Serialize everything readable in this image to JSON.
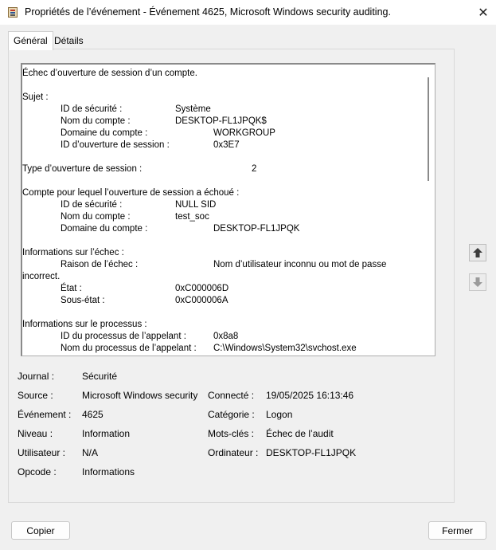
{
  "window": {
    "title": "Propriétés de l’événement - Événement 4625, Microsoft Windows security auditing.",
    "close_glyph": "✕"
  },
  "tabs": [
    {
      "label": "Général",
      "active": true
    },
    {
      "label": "Détails",
      "active": false
    }
  ],
  "description": {
    "lines": [
      {
        "text": "Échec d’ouverture de session d’un compte.",
        "col": 0,
        "row": 0
      },
      {
        "text": "Sujet :",
        "col": 0,
        "row": 2
      },
      {
        "text": "ID de sécurité :",
        "col": 1,
        "row": 3,
        "value": "Système",
        "vcol": 2
      },
      {
        "text": "Nom du compte :",
        "col": 1,
        "row": 4,
        "value": "DESKTOP-FL1JPQK$",
        "vcol": 2
      },
      {
        "text": "Domaine du compte :",
        "col": 1,
        "row": 5,
        "value": "WORKGROUP",
        "vcol": 3
      },
      {
        "text": "ID d’ouverture de session :",
        "col": 1,
        "row": 6,
        "value": "0x3E7",
        "vcol": 3
      },
      {
        "text": "Type d’ouverture de session :",
        "col": 0,
        "row": 8,
        "value": "2",
        "vcol": 4
      },
      {
        "text": "Compte pour lequel l’ouverture de session a échoué :",
        "col": 0,
        "row": 10
      },
      {
        "text": "ID de sécurité :",
        "col": 1,
        "row": 11,
        "value": "NULL SID",
        "vcol": 2
      },
      {
        "text": "Nom du compte :",
        "col": 1,
        "row": 12,
        "value": "test_soc",
        "vcol": 2
      },
      {
        "text": "Domaine du compte :",
        "col": 1,
        "row": 13,
        "value": "DESKTOP-FL1JPQK",
        "vcol": 3
      },
      {
        "text": "Informations sur l’échec :",
        "col": 0,
        "row": 15
      },
      {
        "text": "Raison de l’échec :",
        "col": 1,
        "row": 16,
        "value": "Nom d’utilisateur inconnu ou mot de passe",
        "vcol": 3
      },
      {
        "text": "incorrect.",
        "col": 0,
        "row": 17
      },
      {
        "text": "État :",
        "col": 1,
        "row": 18,
        "value": "0xC000006D",
        "vcol": 2
      },
      {
        "text": "Sous-état :",
        "col": 1,
        "row": 19,
        "value": "0xC000006A",
        "vcol": 2
      },
      {
        "text": "Informations sur le processus :",
        "col": 0,
        "row": 21
      },
      {
        "text": "ID du processus de l’appelant :",
        "col": 1,
        "row": 22,
        "value": "0x8a8",
        "vcol": 3
      },
      {
        "text": "Nom du processus de l’appelant :",
        "col": 1,
        "row": 23,
        "value": "C:\\Windows\\System32\\svchost.exe",
        "vcol": 3
      }
    ]
  },
  "side_buttons": {
    "up_icon": "arrow-up-icon",
    "down_icon": "arrow-down-icon"
  },
  "info": {
    "journal_label": "Journal :",
    "journal_value": "Sécurité",
    "source_label": "Source :",
    "source_value": "Microsoft Windows security",
    "connecte_label": "Connecté :",
    "connecte_value": "19/05/2025 16:13:46",
    "evenement_label": "Événement :",
    "evenement_value": "4625",
    "categorie_label": "Catégorie :",
    "categorie_value": "Logon",
    "niveau_label": "Niveau :",
    "niveau_value": "Information",
    "motscles_label": "Mots-clés :",
    "motscles_value": "Échec de l’audit",
    "utilisateur_label": "Utilisateur :",
    "utilisateur_value": "N/A",
    "ordinateur_label": "Ordinateur :",
    "ordinateur_value": "DESKTOP-FL1JPQK",
    "opcode_label": "Opcode :",
    "opcode_value": "Informations"
  },
  "buttons": {
    "copy": "Copier",
    "close": "Fermer"
  }
}
